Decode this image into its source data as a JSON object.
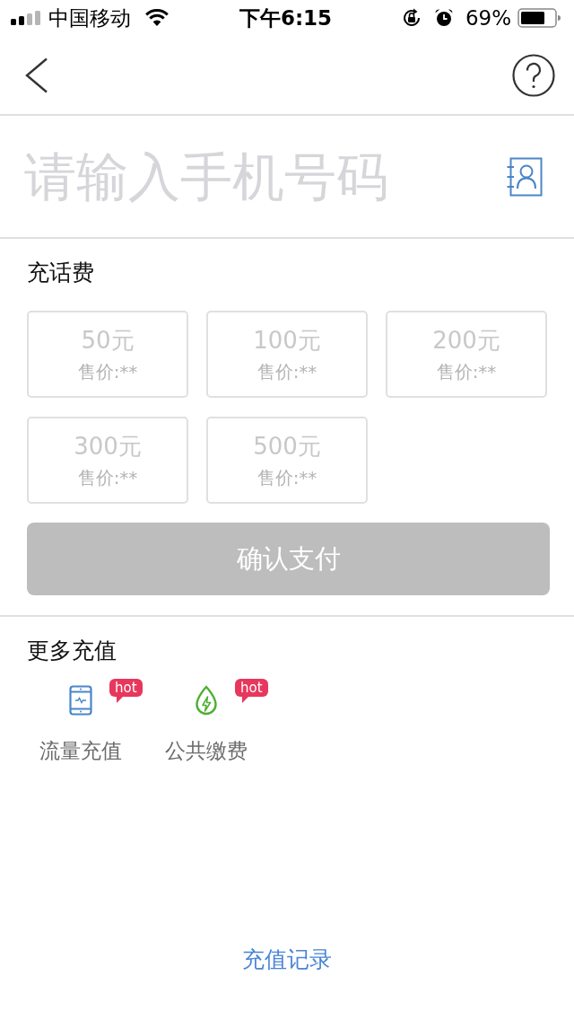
{
  "status_bar": {
    "carrier": "中国移动",
    "time": "下午6:15",
    "battery": "69%"
  },
  "phone_input": {
    "placeholder": "请输入手机号码"
  },
  "topup": {
    "title": "充话费",
    "options": [
      {
        "amount": "50元",
        "price": "售价:**",
        "disabled": true
      },
      {
        "amount": "100元",
        "price": "售价:**",
        "disabled": true
      },
      {
        "amount": "200元",
        "price": "售价:**",
        "disabled": true
      },
      {
        "amount": "300元",
        "price": "售价:**",
        "disabled": true
      },
      {
        "amount": "500元",
        "price": "售价:**",
        "disabled": true
      }
    ]
  },
  "confirm_button": {
    "label": "确认支付",
    "disabled": true
  },
  "more": {
    "title": "更多充值",
    "items": [
      {
        "kind": "mobile-data",
        "label": "流量充值",
        "badge": "hot"
      },
      {
        "kind": "utility",
        "label": "公共缴费",
        "badge": "hot"
      }
    ]
  },
  "history_link": {
    "label": "充值记录"
  }
}
